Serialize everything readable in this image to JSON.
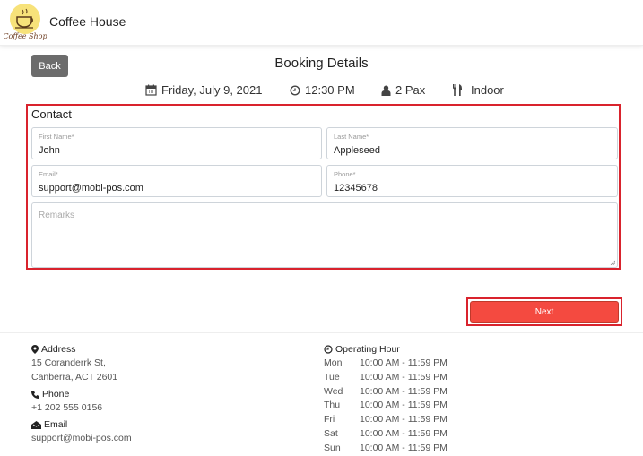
{
  "header": {
    "logo_text": "Coffee Shop",
    "brand": "Coffee House"
  },
  "booking": {
    "back_label": "Back",
    "title": "Booking Details",
    "date": "Friday, July 9, 2021",
    "time": "12:30 PM",
    "pax": "2 Pax",
    "seating": "Indoor"
  },
  "contact": {
    "section_label": "Contact",
    "first_name": {
      "label": "First Name*",
      "value": "John"
    },
    "last_name": {
      "label": "Last Name*",
      "value": "Appleseed"
    },
    "email": {
      "label": "Email*",
      "value": "support@mobi-pos.com"
    },
    "phone": {
      "label": "Phone*",
      "value": "12345678"
    },
    "remarks": {
      "placeholder": "Remarks",
      "value": ""
    }
  },
  "actions": {
    "next_label": "Next"
  },
  "colors": {
    "accent": "#f44a40",
    "highlight": "#d9232d"
  },
  "footer": {
    "address_label": "Address",
    "address_line1": "15 Coranderrk St,",
    "address_line2": "Canberra, ACT 2601",
    "phone_label": "Phone",
    "phone": "+1 202 555 0156",
    "email_label": "Email",
    "email": "support@mobi-pos.com",
    "hours_label": "Operating Hour",
    "hours": [
      {
        "day": "Mon",
        "time": "10:00 AM - 11:59 PM"
      },
      {
        "day": "Tue",
        "time": "10:00 AM - 11:59 PM"
      },
      {
        "day": "Wed",
        "time": "10:00 AM - 11:59 PM"
      },
      {
        "day": "Thu",
        "time": "10:00 AM - 11:59 PM"
      },
      {
        "day": "Fri",
        "time": "10:00 AM - 11:59 PM"
      },
      {
        "day": "Sat",
        "time": "10:00 AM - 11:59 PM"
      },
      {
        "day": "Sun",
        "time": "10:00 AM - 11:59 PM"
      }
    ]
  }
}
